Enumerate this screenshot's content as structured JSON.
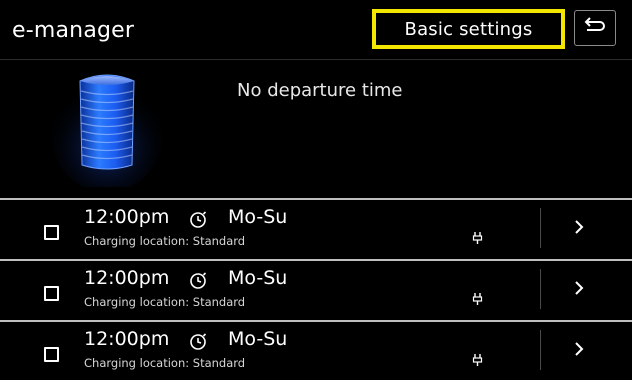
{
  "header": {
    "title": "e-manager",
    "basic_settings_label": "Basic settings",
    "back_icon": "return-arrow-icon"
  },
  "status": {
    "no_departure_text": "No departure time",
    "battery_icon": "battery-icon"
  },
  "timers": [
    {
      "checked": false,
      "time": "12:00pm",
      "days": "Mo-Su",
      "location": "Charging location: Standard"
    },
    {
      "checked": false,
      "time": "12:00pm",
      "days": "Mo-Su",
      "location": "Charging location: Standard"
    },
    {
      "checked": false,
      "time": "12:00pm",
      "days": "Mo-Su",
      "location": "Charging location: Standard"
    }
  ],
  "colors": {
    "highlight": "#f3e600",
    "battery_glow": "#1f5bff",
    "background": "#000000",
    "row_separator": "#bfbfbf"
  }
}
